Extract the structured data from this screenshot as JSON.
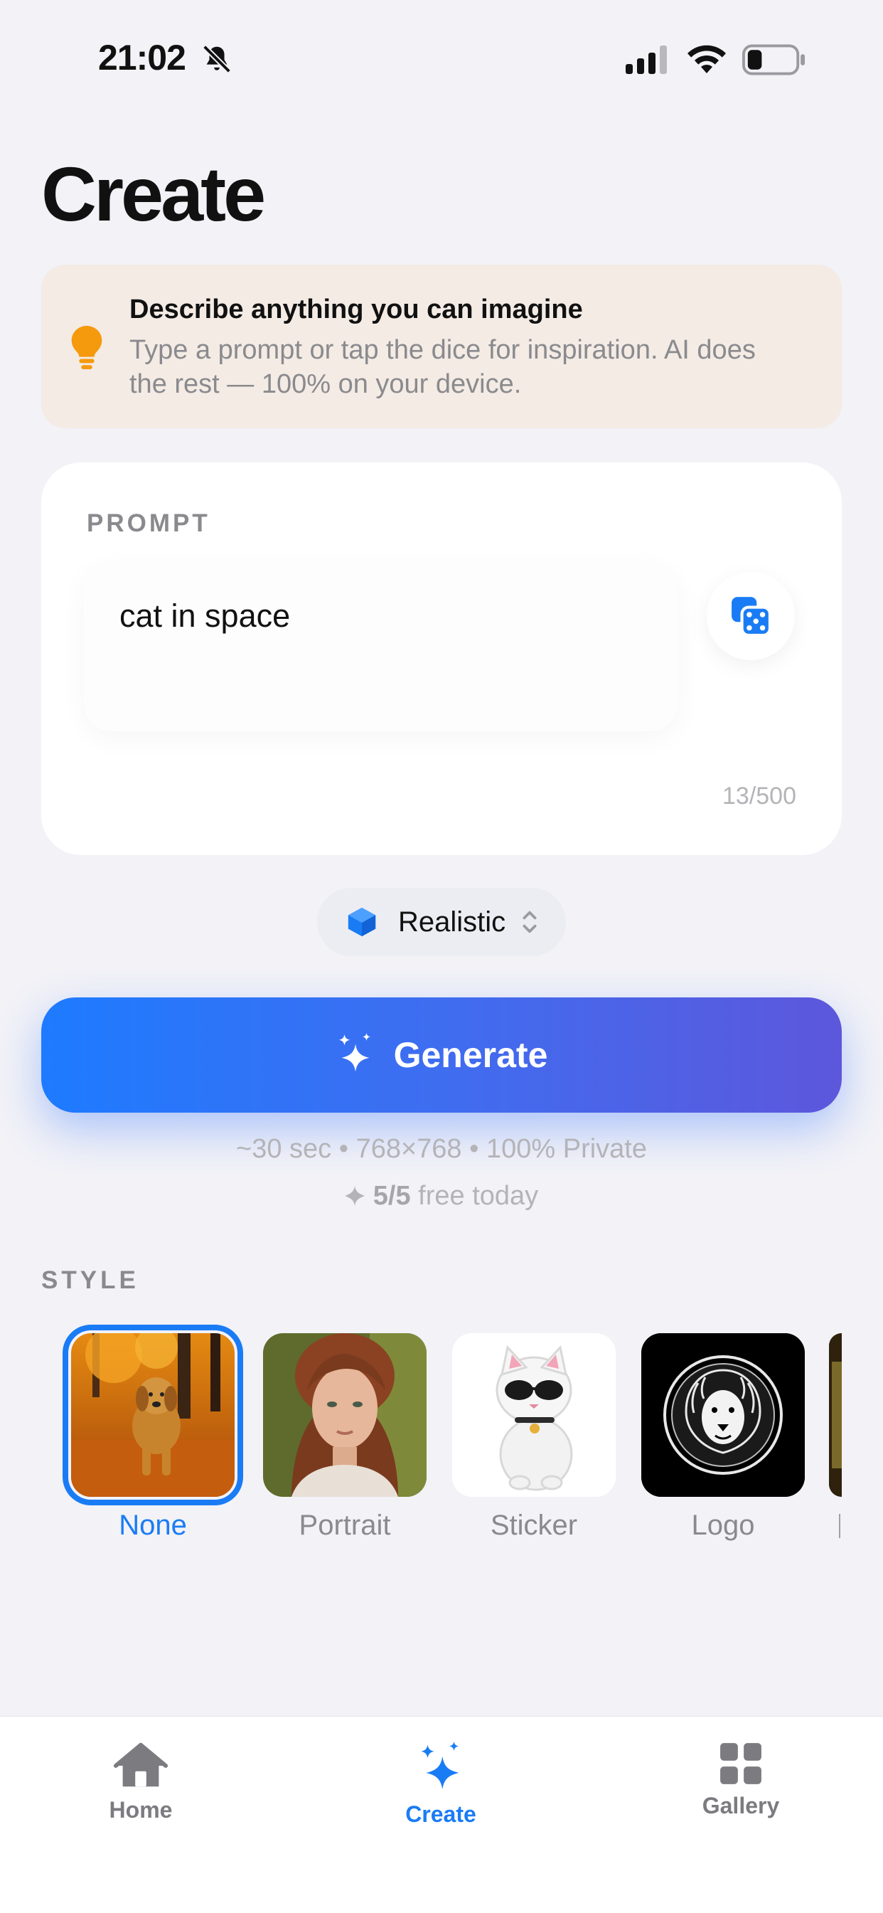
{
  "status_bar": {
    "time": "21:02",
    "icons": [
      "bell-slash-icon",
      "cellular-signal-icon",
      "wifi-icon",
      "battery-icon"
    ]
  },
  "page": {
    "title": "Create"
  },
  "tip": {
    "icon": "lightbulb-icon",
    "title": "Describe anything you can imagine",
    "body": "Type a prompt or tap the dice for inspiration. AI does the rest — 100% on your device."
  },
  "prompt": {
    "label": "PROMPT",
    "value": "cat in space",
    "dice_icon": "dice-icon",
    "char_count": "13/500"
  },
  "style_picker": {
    "icon": "cube-icon",
    "label": "Realistic",
    "chevron_icon": "chevron-up-down-icon"
  },
  "generate": {
    "icon": "sparkles-icon",
    "label": "Generate",
    "meta": "~30 sec • 768×768 • 100% Private",
    "free_count": "5/5",
    "free_suffix": " free today",
    "free_icon": "sparkle-icon"
  },
  "styles": {
    "heading": "STYLE",
    "items": [
      {
        "label": "None",
        "selected": true
      },
      {
        "label": "Portrait",
        "selected": false
      },
      {
        "label": "Sticker",
        "selected": false
      },
      {
        "label": "Logo",
        "selected": false
      },
      {
        "label": "",
        "selected": false
      }
    ]
  },
  "tabs": [
    {
      "label": "Home",
      "icon": "house-icon",
      "active": false
    },
    {
      "label": "Create",
      "icon": "sparkles-icon",
      "active": true
    },
    {
      "label": "Gallery",
      "icon": "grid-icon",
      "active": false
    }
  ],
  "colors": {
    "accent": "#1a7cf5",
    "tip_background": "#f3ebe4",
    "gradient_start": "#1e7bff",
    "gradient_end": "#5d57dc",
    "bulb": "#f59a0c"
  }
}
